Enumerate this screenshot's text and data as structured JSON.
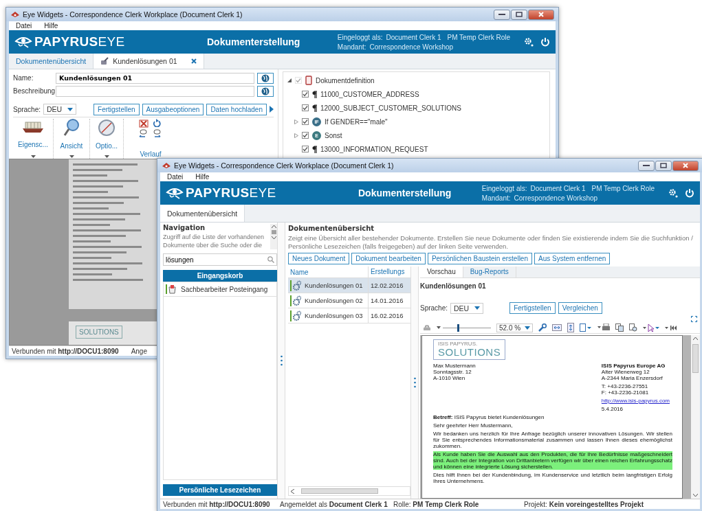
{
  "back_window": {
    "title": "Eye Widgets - Correspondence Clerk Workplace (Document Clerk 1)",
    "menu": [
      "Datei",
      "Hilfe"
    ],
    "header": {
      "logo_bold": "PAPYRUS",
      "logo_light": "EYE",
      "title": "Dokumenterstellung",
      "login_label": "Eingeloggt als:",
      "user": "Document Clerk 1",
      "role": "PM Temp Clerk Role",
      "tenant_label": "Mandant:",
      "tenant": "Correspondence Workshop"
    },
    "tabs": [
      {
        "label": "Dokumentenübersicht",
        "selected": false,
        "closable": false
      },
      {
        "label": "Kundenlösungen 01",
        "selected": true,
        "closable": true
      }
    ],
    "form": {
      "name_label": "Name:",
      "name_value": "Kundenlösungen 01",
      "description_label": "Beschreibung:",
      "language_label": "Sprache:",
      "language": "DEU",
      "buttons": [
        "Fertigstellen",
        "Ausgabeoptionen",
        "Daten hochladen"
      ]
    },
    "ribbon": [
      {
        "kind": "properties",
        "label": "Eigensc..."
      },
      {
        "kind": "view",
        "label": "Ansicht"
      },
      {
        "kind": "options",
        "label": "Optio..."
      },
      {
        "kind": "history",
        "label": "Verlauf"
      }
    ],
    "tree": [
      {
        "label": "Dokumentdefinition",
        "kind": "document",
        "checked": true,
        "disabled": true,
        "expanded": true,
        "children": [
          {
            "label": "11000_CUSTOMER_ADDRESS",
            "kind": "paragraph",
            "checked": true,
            "disabled": false
          },
          {
            "label": "12000_SUBJECT_CUSTOMER_SOLUTIONS",
            "kind": "paragraph",
            "checked": true,
            "disabled": false
          },
          {
            "label": "If GENDER==\"male\"",
            "kind": "condition",
            "badge": "IF",
            "checked": true,
            "disabled": false,
            "expanded": false
          },
          {
            "label": "Sonst",
            "kind": "else",
            "badge": "E",
            "checked": true,
            "disabled": false,
            "expanded": false
          },
          {
            "label": "13000_INFORMATION_REQUEST",
            "kind": "paragraph",
            "checked": true,
            "disabled": false
          }
        ]
      }
    ],
    "preview": {
      "logo_text": "SOLUTIONS"
    },
    "status": {
      "connection": "Verbunden mit **http://DOCU1:8090**",
      "cut_text": "Ange"
    }
  },
  "front_window": {
    "title": "Eye Widgets - Correspondence Clerk Workplace (Document Clerk 1)",
    "menu": [
      "Datei",
      "Hilfe"
    ],
    "header": {
      "logo_bold": "PAPYRUS",
      "logo_light": "EYE",
      "title": "Dokumenterstellung",
      "login_label": "Eingeloggt als:",
      "user": "Document Clerk 1",
      "role": "PM Temp Clerk Role",
      "tenant_label": "Mandant:",
      "tenant": "Correspondence Workshop"
    },
    "tabs": [
      {
        "label": "Dokumentenübersicht",
        "selected": true
      }
    ],
    "navigation": {
      "title": "Navigation",
      "description": "Zugriff auf die Liste der vorhandenen Dokumente über die Suche oder die",
      "search": "lösungen",
      "inbox_title": "Eingangskorb",
      "inbox_items": [
        {
          "label": "Sachbearbeiter Posteingang",
          "selected": false
        }
      ],
      "bookmarks_title": "Persönliche Lesezeichen"
    },
    "overview": {
      "title": "Dokumentenübersicht",
      "description": "Zeigt eine Übersicht aller bestehender Dokumente. Erstellen Sie neue Dokumente oder finden Sie existierende indem Sie die Suchfunktion / Persönliche Lesezeichen (falls freigegeben) auf der linken Seite verwenden.",
      "buttons": [
        "Neues Dokument",
        "Dokument bearbeiten",
        "Persönlichen Baustein erstellen",
        "Aus System entfernen"
      ],
      "columns": [
        "Name",
        "Erstellungs"
      ],
      "rows": [
        {
          "name": "Kundenlösungen 01",
          "date": "12.02.2016",
          "selected": true
        },
        {
          "name": "Kundenlösungen 02",
          "date": "14.01.2016",
          "selected": false
        },
        {
          "name": "Kundenlösungen 03",
          "date": "16.02.2016",
          "selected": false
        }
      ]
    },
    "preview": {
      "tabs": [
        {
          "label": "Vorschau",
          "selected": true
        },
        {
          "label": "Bug-Reports",
          "selected": false
        }
      ],
      "title": "Kundenlösungen 01",
      "language_label": "Sprache:",
      "language": "DEU",
      "buttons": [
        "Fertigstellen",
        "Vergleichen"
      ],
      "zoom": "52.0 %",
      "zoom_slider": {
        "level": 0.3
      },
      "letter": {
        "logo_small": "ISIS PAPYRUS.",
        "logo": "SOLUTIONS",
        "recipient": [
          "Max Mustermann",
          "Sonntagsstr. 12",
          "A-1010 Wien"
        ],
        "sender_name": "ISIS Papyrus Europe AG",
        "sender_lines": [
          "Alter Wienerweg 12",
          "A-2344 Maria Enzersdorf"
        ],
        "contact": [
          "T: +43-2236-27551",
          "F: +43-2236-21081"
        ],
        "link": "http://www.isis-papyrus.com",
        "date": "5.4.2016",
        "subject": "**Betreff:** ISIS Papyrus bietet Kundenlösungen",
        "greeting": "Sehr geehrter Herr Mustermann,",
        "paragraphs": [
          {
            "text": "Wir bedanken uns herzlich für Ihre Anfrage bezüglich unserer innovativen Lösungen. Wir stellen für Sie entsprechendes Informationsmaterial zusammen und lassen Ihnen dieses ehemöglichst zukommen.",
            "highlighted": false
          },
          {
            "text": "Als Kunde haben Sie die Auswahl aus den Produkten, die für Ihre Bedürfnisse maßgeschneidert sind. Auch bei der Integration von Drittanbietern verfügen wir über einen reichen Erfahrungsschatz und können eine integrierte Lösung sicherstellen.",
            "highlighted": true
          },
          {
            "text": "Dies hilft Ihnen bei der Kundenbindung, im Kundenservice und letztlich beim langfristigen Erfolg Ihres Unternehmens.",
            "highlighted": false
          }
        ]
      }
    },
    "status": [
      "Verbunden mit **http://DOCU1:8090**",
      "Angemeldet als **Document Clerk 1**",
      "Rolle: **PM Temp Clerk Role**",
      "Projekt: **Kein voreingestelltes Projekt**"
    ]
  }
}
